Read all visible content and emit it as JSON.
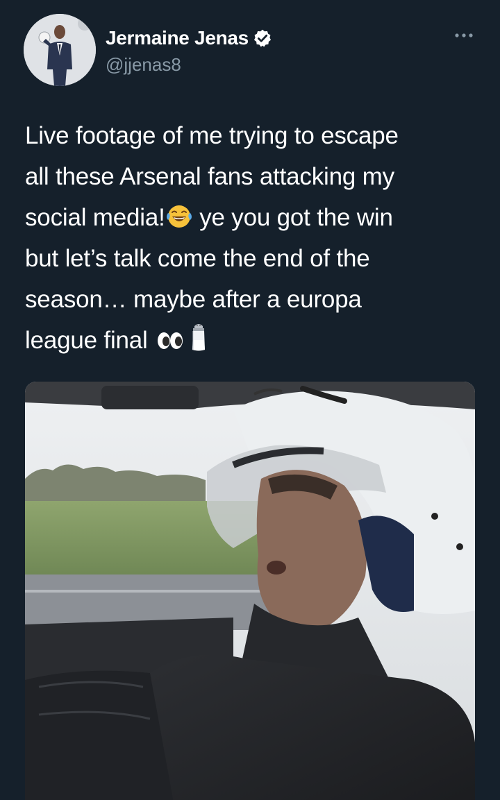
{
  "author": {
    "display_name": "Jermaine Jenas",
    "handle": "@jjenas8",
    "verified": true
  },
  "tweet": {
    "lines": [
      "Live footage of me trying to escape",
      "all these Arsenal fans attacking my",
      "social media!",
      " ye you got the win",
      "but let’s talk come the end of the",
      "season… maybe after a europa",
      "league final "
    ]
  },
  "icons": {
    "verified": "verified-badge-icon",
    "more": "more-horizontal-icon",
    "laughing": "face-with-tears-of-joy-emoji",
    "eyes": "eyes-emoji",
    "salt": "salt-shaker-emoji"
  },
  "colors": {
    "background": "#15202b",
    "text": "#ffffff",
    "secondary_text": "#8899a6"
  }
}
